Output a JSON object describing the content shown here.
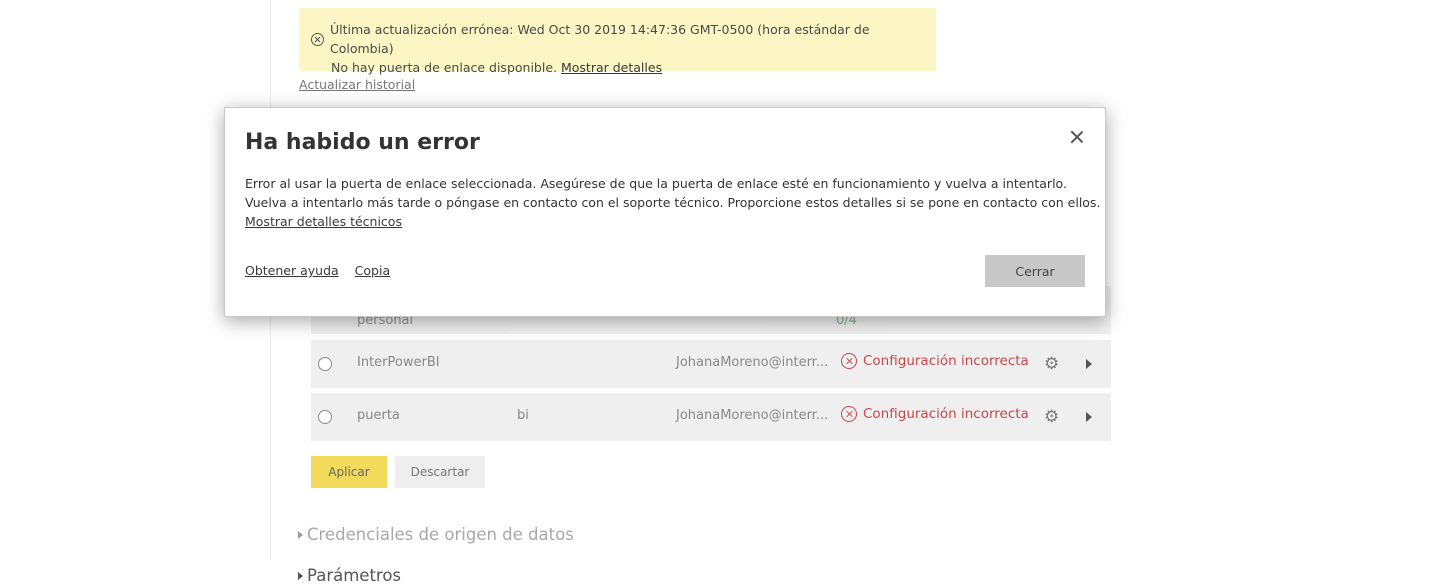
{
  "banner": {
    "line1": "Última actualización errónea: Wed Oct 30 2019 14:47:36 GMT-0500 (hora estándar de Colombia)",
    "line2": "No hay puerta de enlace disponible.",
    "details_link": "Mostrar detalles",
    "icon": "error-circle-icon"
  },
  "history_link": "Actualizar historial",
  "gateways": [
    {
      "name": "personal",
      "b": "",
      "owner": "",
      "status": "0/4"
    },
    {
      "name": "InterPowerBI",
      "b": "",
      "owner": "JohanaMoreno@interr...",
      "status": "Configuración incorrecta"
    },
    {
      "name": "puerta",
      "b": "bi",
      "owner": "JohanaMoreno@interr...",
      "status": "Configuración incorrecta"
    }
  ],
  "buttons": {
    "apply": "Aplicar",
    "discard": "Descartar"
  },
  "sections": {
    "credentials": "Credenciales de origen de datos",
    "parameters": "Parámetros"
  },
  "dialog": {
    "title": "Ha habido un error",
    "message_line1": "Error al usar la puerta de enlace seleccionada. Asegúrese de que la puerta de enlace esté en funcionamiento y vuelva a intentarlo.",
    "message_line2": "Vuelva a intentarlo más tarde o póngase en contacto con el soporte técnico. Proporcione estos detalles si se pone en contacto con ellos.",
    "tech_details_link": "Mostrar detalles técnicos",
    "help_link": "Obtener ayuda",
    "copy_link": "Copia",
    "close_button": "Cerrar"
  },
  "colors": {
    "banner_bg": "#fbf6c3",
    "error_red": "#c4484c",
    "apply_yellow": "#f2da5c"
  }
}
